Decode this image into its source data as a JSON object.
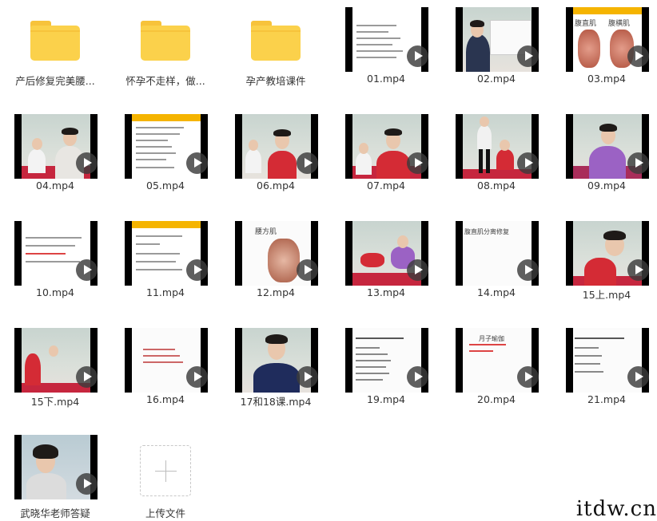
{
  "folders": [
    {
      "name": "产后修复完美腰..."
    },
    {
      "name": "怀孕不走样，做..."
    },
    {
      "name": "孕产教培课件"
    }
  ],
  "videos": [
    {
      "name": "01.mp4"
    },
    {
      "name": "02.mp4"
    },
    {
      "name": "03.mp4",
      "thumb_text_left": "腹直肌",
      "thumb_text_right": "腹横肌"
    },
    {
      "name": "04.mp4"
    },
    {
      "name": "05.mp4"
    },
    {
      "name": "06.mp4"
    },
    {
      "name": "07.mp4"
    },
    {
      "name": "08.mp4"
    },
    {
      "name": "09.mp4"
    },
    {
      "name": "10.mp4"
    },
    {
      "name": "11.mp4"
    },
    {
      "name": "12.mp4",
      "thumb_text": "腰方肌"
    },
    {
      "name": "13.mp4"
    },
    {
      "name": "14.mp4",
      "thumb_text": "腹直肌分离修复"
    },
    {
      "name": "15上.mp4"
    },
    {
      "name": "15下.mp4"
    },
    {
      "name": "16.mp4"
    },
    {
      "name": "17和18课.mp4"
    },
    {
      "name": "19.mp4"
    },
    {
      "name": "20.mp4",
      "thumb_text": "月子瑜伽"
    },
    {
      "name": "21.mp4"
    },
    {
      "name": "武晓华老师答疑"
    }
  ],
  "upload": {
    "label": "上传文件"
  },
  "watermark": "itdw.cn",
  "colors": {
    "folder": "#fbd14b",
    "folder_dark": "#f7c33b",
    "doc_bar": "#f5b400",
    "mat": "#c6263e"
  }
}
